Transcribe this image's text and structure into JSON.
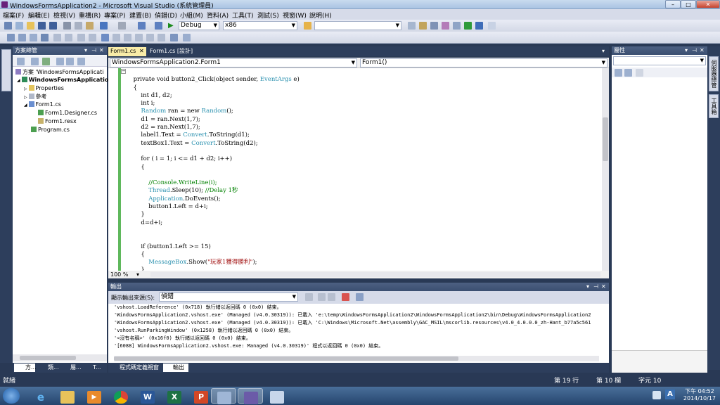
{
  "window": {
    "title": "WindowsFormsApplication2 - Microsoft Visual Studio (系統管理員)",
    "minimize": "–",
    "maximize": "□",
    "close": "✕"
  },
  "menu": [
    "檔案(F)",
    "編輯(E)",
    "檢視(V)",
    "重構(R)",
    "專案(P)",
    "建置(B)",
    "偵錯(D)",
    "小組(M)",
    "資料(A)",
    "工具(T)",
    "測試(S)",
    "視窗(W)",
    "說明(H)"
  ],
  "toolbar": {
    "configuration": "Debug",
    "platform": "x86",
    "find_value": ""
  },
  "solution_explorer": {
    "title": "方案總管",
    "items": [
      {
        "label": "方案 'WindowsFormsApplicati"
      },
      {
        "label": "WindowsFormsApplication"
      },
      {
        "label": "Properties"
      },
      {
        "label": "參考"
      },
      {
        "label": "Form1.cs"
      },
      {
        "label": "Form1.Designer.cs"
      },
      {
        "label": "Form1.resx"
      },
      {
        "label": "Program.cs"
      }
    ]
  },
  "tabs": [
    {
      "label": "Form1.cs"
    },
    {
      "label": "Form1.cs [設計]"
    }
  ],
  "navbar": {
    "class_combo": "WindowsFormsApplication2.Form1",
    "member_combo": "Form1()"
  },
  "code": {
    "l1a": "        private void button2_Click(object sender, ",
    "l1b": "EventArgs",
    "l1c": " e)",
    "l2": "        {",
    "l3": "            int d1, d2;",
    "l4": "            int i;",
    "l5a": "            ",
    "l5b": "Random",
    "l5c": " ran = new ",
    "l5d": "Random",
    "l5e": "();",
    "l6": "            d1 = ran.Next(1,7);",
    "l7": "            d2 = ran.Next(1,7);",
    "l8a": "            label1.Text = ",
    "l8b": "Convert",
    "l8c": ".ToString(d1);",
    "l9a": "            textBox1.Text = ",
    "l9b": "Convert",
    "l9c": ".ToString(d2);",
    "l10": "",
    "l11": "            for ( i = 1; i <= d1 + d2; i++)",
    "l12": "            {",
    "l13": "",
    "l14": "                //Console.WriteLine(i);",
    "l15a": "                ",
    "l15b": "Thread",
    "l15c": ".Sleep(10); ",
    "l15d": "//Delay 1秒",
    "l16a": "                ",
    "l16b": "Application",
    "l16c": ".DoEvents();",
    "l17": "                button1.Left = d+i;",
    "l18": "            }",
    "l19": "            d=d+i;",
    "l20": "",
    "l21": "",
    "l22": "            if (button1.Left >= 15)",
    "l23": "            {",
    "l24a": "                ",
    "l24b": "MessageBox",
    "l24c": ".Show(",
    "l24d": "\"玩家1獲得勝利\"",
    "l24e": ");",
    "l25": "            }"
  },
  "editor_status": {
    "zoom": "100 %"
  },
  "output": {
    "title": "輸出",
    "source_label": "顯示輸出來源(S):",
    "source_value": "偵錯",
    "lines": [
      "'vshost.LoadReference' (0x718) 執行緒以返回碼 0 (0x0) 結束。",
      "'WindowsFormsApplication2.vshost.exe' (Managed (v4.0.30319)): 已載入 'e:\\temp\\WindowsFormsApplication2\\WindowsFormsApplication2\\bin\\Debug\\WindowsFormsApplication2",
      "'WindowsFormsApplication2.vshost.exe' (Managed (v4.0.30319)): 已載入 'C:\\Windows\\Microsoft.Net\\assembly\\GAC_MSIL\\mscorlib.resources\\v4.0_4.0.0.0_zh-Hant_b77a5c561",
      "'vshost.RunParkingWindow' (0x1258) 執行緒以返回碼 0 (0x0) 結束。",
      "'<沒有名稱>' (0x16f0) 執行緒以返回碼 0 (0x0) 結束。",
      "'[6088] WindowsFormsApplication2.vshost.exe: Managed (v4.0.30319)' 程式以返回碼 0 (0x0) 結束。"
    ]
  },
  "bottom_tabs": [
    {
      "label": "程式碼定義視窗"
    },
    {
      "label": "輸出"
    }
  ],
  "left_tabs": [
    {
      "label": "方..."
    },
    {
      "label": "類..."
    },
    {
      "label": "屬..."
    },
    {
      "label": "T..."
    }
  ],
  "properties": {
    "title": "屬性"
  },
  "right_tabs": [
    "伺服器總管",
    "工具箱"
  ],
  "status": {
    "ready": "就緒",
    "line": "第 19 行",
    "col": "第 10 欄",
    "char": "字元 10"
  },
  "taskbar": {
    "time": "下午 04:52",
    "date": "2014/10/17",
    "ime": "A"
  }
}
